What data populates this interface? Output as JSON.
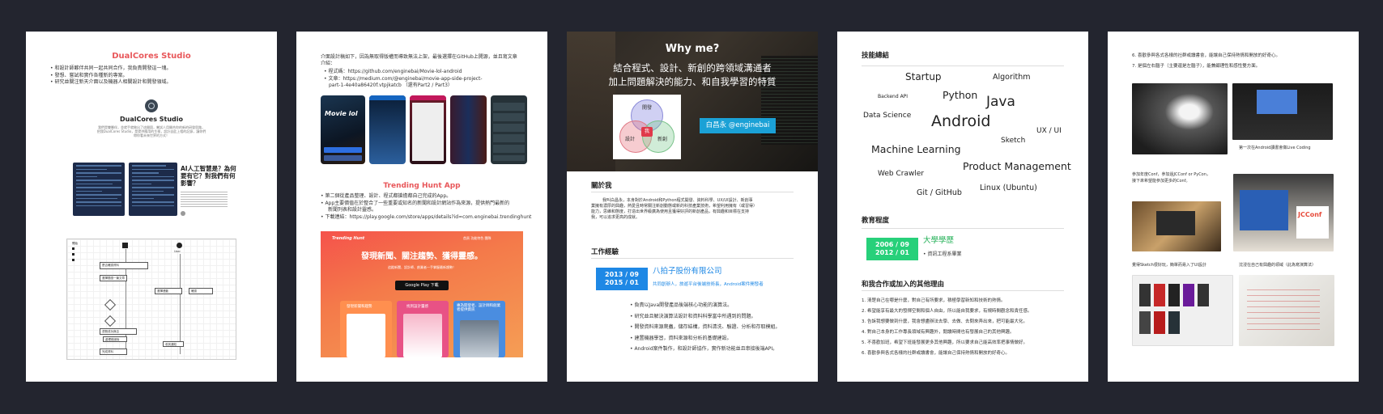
{
  "page1": {
    "title": "DualCores Studio",
    "bullets": [
      "和設計師夥伴共同一起共同合作，我負責開發這一塊。",
      "發想、嘗試和實作各種新的專案。",
      "研究並關注新天介面以及機器人相關設計和開發領域。"
    ],
    "card_title": "DualCores Studio",
    "card_desc_1": "我們是雙夥伴，並就手就做出了這間園，嘗試人用開合你的新的研發思路，",
    "card_desc_2": "把我DualCores Studio，是提供應用的生根，設計自此上相的記錄，讓你們",
    "card_desc_3": "帶你看未來世界的方式！",
    "article_title_1": "AI人工智慧是？為何",
    "article_title_2": "要有它？對我們有何",
    "article_title_3": "影響？",
    "flow_start": "開始",
    "flow_user": "User",
    "flow_labels": [
      "是否確認資料",
      "選擇閱讀一篇文章",
      "選擇連動",
      "確認",
      "完成推薦",
      "收到通知",
      "瀏覽成功與否",
      "處理錯誤後",
      "完成資料",
      "失敗"
    ]
  },
  "page2": {
    "intro_1": "介面設計稿如下，因為無取得版權而導致無法上架，最後選擇在GitHub上開源，並且寫文章",
    "intro_2": "介紹：",
    "code_label": "程式碼：https://github.com/enginebai/Movie-lol-android",
    "article_label": "文章：https://medium.com/@enginebai/movie-app-side-project-",
    "article_label_2": "part-1-4e40a86420f.vtpjkatcb （還有Part2 / Part3）",
    "app_name": "Movie lol",
    "section_title": "Trending Hunt App",
    "bullets": [
      "第二個從產品整理、設計、程式都搶擔都自己完成的App。",
      "App主要價值在於整合了一些重要或知名的新聞和設計網站作為來源，提供熱門最新的",
      "新聞列表和設計靈感。",
      "下載連結：https://play.google.com/store/apps/details?id=com.enginebai.trendinghunt"
    ],
    "banner_brand": "Trending Hunt",
    "banner_nav": "首頁  功能特色  團隊",
    "banner_headline": "發現新聞、關注趨勢、獲得靈感。",
    "banner_sub": "追蹤新聞、設計師、創業者一手掌握最新趨勢！",
    "play_button": "Google Play 下載",
    "card_1": "發現新聞和趨勢",
    "card_2": "找到設計靈感",
    "card_3": "專為開發者、設計師和創業者提供資訊"
  },
  "page3": {
    "hero_title": "Why me?",
    "hero_line_1": "結合程式、設計、新創的跨領域溝通者",
    "hero_line_2": "加上問題解決的能力、和自我學習的特質",
    "venn_dev": "開發",
    "venn_design": "設計",
    "venn_startup": "新創",
    "venn_center": "我",
    "name_badge": "白昌永 @enginebai",
    "about_title": "關於我",
    "about_lines": [
      "我叫白昌永，本身對於Android和Python程式開發、資料科學、UX/UI設計、新創事",
      "業擁有濃厚的興趣，熱愛且時常關注新創動態或新的科技產業技術，希望利用擁有（或習得）",
      "能力，思維和態度，打造出世界級廣為使用且獲得好評的新創產品，有興趣和目標在支持",
      "我，可以追求更高的成就。"
    ],
    "work_title": "工作經驗",
    "work_date": "2013 / 09\n2015 / 01",
    "work_date_1": "2013 / 09",
    "work_date_2": "2015 / 01",
    "company": "八拍子股份有限公司",
    "role": "共同創辦人，旅遊平台後端技術長，Android案件開發者",
    "work_bullets": [
      "負責以Java開發產品後端核心功能的演算法。",
      "研究並且解決演算法設計和資料科學當中所遇到的問題。",
      "開發資料來源爬蟲，儲存結構，資料清洗、驗證、分析和存取模組。",
      "建置機器學習，資料來源和分析的基礎建設。",
      "Android案件製作，和設計師協作，實作新功能並且串接後端API。"
    ]
  },
  "page4": {
    "skills_title": "技能總結",
    "words": [
      "Startup",
      "Algorithm",
      "Backend API",
      "Python",
      "Java",
      "Data Science",
      "Android",
      "UX / UI",
      "Sketch",
      "Machine Learning",
      "Product Management",
      "Web Crawler",
      "Git / GitHub",
      "Linux (Ubuntu)"
    ],
    "edu_title": "教育程度",
    "edu_date_1": "2006 / 09",
    "edu_date_2": "2012 / 01",
    "school": "大學學歷",
    "dept": "資訊工程系畢業",
    "coop_title": "和我合作或加入的其他理由",
    "reasons": [
      "1.   清楚自己在哪是什麼，對自己有所要求，積極學習新知和技術的熱情。",
      "2.   希望能享有最大的發揮空間和個人自由，所以能自我要求，有規時間觀念和責任感。",
      "3.   告訴我想要做到什麼，我會想盡辦法去學、去做、去問來弄出來，把可能最大化。",
      "4.   對自己本身的工作專長領域有興趣外，閱讀時間也有發展自己的其他興趣。",
      "5.   不喜歡加班，希望下班能發展更多其他興趣，所以要求自己能高效率把事情做好。",
      "6.   喜歡參與各式各樣的社群或讀書會，能讓自己保持熱情和開放的好奇心。"
    ]
  },
  "page5": {
    "reasons": [
      "6.   喜歡參與各式各樣的社群或讀書會，能讓自己保持熱情和開放的好奇心。",
      "7.   是個左右腦子（主要還是左腦子），能兼顧理性和感性雙方面。"
    ],
    "caption_1": "第一次在Android讀書會做Live Coding",
    "caption_2_a": "參加年度Conf，參加過JCConf or PyCon，",
    "caption_2_b": "接下來希望能參加更多的Conf。",
    "conf_logo": "JCConf",
    "caption_3": "覺得Sketch很好玩，簡單而易入了UI設計",
    "caption_4": "沈浸在自己有興趣的領域（此為寫演算法）"
  },
  "colors": {
    "background": "#23252f",
    "red": "#e8575a",
    "green": "#27b25a",
    "blue": "#1e88e5",
    "teal": "#00bcd4"
  }
}
